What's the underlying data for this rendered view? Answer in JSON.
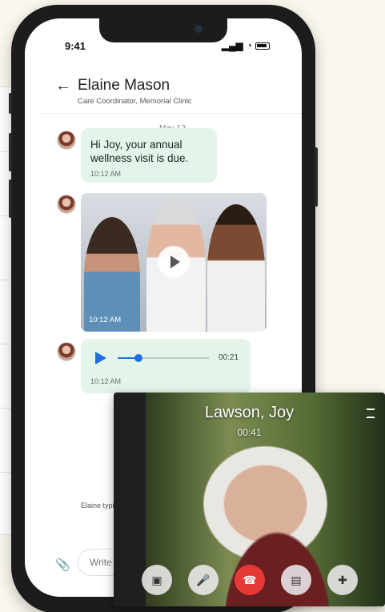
{
  "status_bar": {
    "time": "9:41",
    "signal": "▂▄▆",
    "wifi": "◔"
  },
  "chat_header": {
    "back_icon": "arrow-left",
    "name": "Elaine Mason",
    "subtitle": "Care Coordinator, Memorial Clinic"
  },
  "date_divider": "May 12",
  "messages": [
    {
      "type": "text",
      "text": "Hi Joy, your annual wellness visit is due.",
      "time": "10:12 AM"
    },
    {
      "type": "video",
      "time": "10:12 AM"
    },
    {
      "type": "audio",
      "duration": "00:21",
      "time": "10:12 AM",
      "progress": 0.23
    }
  ],
  "typing_indicator": "Elaine typic",
  "composer": {
    "placeholder": "Write a",
    "attach_icon": "paperclip"
  },
  "video_call": {
    "name": "Lawson, Joy",
    "timer": "00:41",
    "controls": [
      "camera-off",
      "mic-off",
      "end-call",
      "chat",
      "add-person"
    ],
    "end_color": "#e53935"
  },
  "colors": {
    "bubble": "#e3f5e9",
    "accent": "#1f6fe0",
    "attach": "#2f9a52"
  }
}
